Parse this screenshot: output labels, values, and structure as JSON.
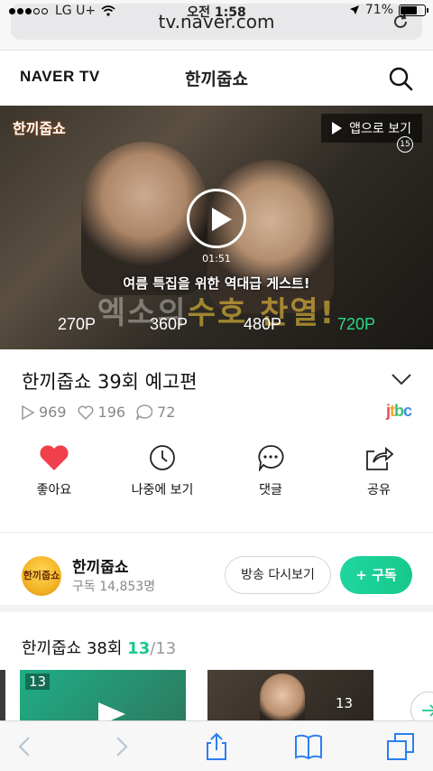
{
  "status_bar": {
    "carrier": "LG U+",
    "time": "오전 1:58",
    "battery": "71%",
    "battery_level": 0.71
  },
  "address_bar": {
    "url": "tv.naver.com"
  },
  "header": {
    "logo": "NAVER TV",
    "title": "한끼줍쇼"
  },
  "video": {
    "show_logo": "한끼줍쇼",
    "open_in_app": "앱으로 보기",
    "age_rating": "15",
    "duration": "01:51",
    "caption_top": "여름 특집을 위한 역대급 게스트!",
    "caption_main": "엑소의",
    "caption_highlight": "수호 찬열!",
    "qualities": [
      "270P",
      "360P",
      "480P",
      "720P"
    ],
    "selected_quality": "720P"
  },
  "info": {
    "title": "한끼줍쇼 39회 예고편",
    "plays": "969",
    "likes": "196",
    "comments": "72",
    "broadcaster": {
      "j": "j",
      "t": "t",
      "b": "b",
      "c": "c"
    }
  },
  "actions": [
    {
      "label": "좋아요",
      "icon": "heart-icon"
    },
    {
      "label": "나중에 보기",
      "icon": "clock-icon"
    },
    {
      "label": "댓글",
      "icon": "comment-icon"
    },
    {
      "label": "공유",
      "icon": "share-icon"
    }
  ],
  "channel": {
    "avatar_text": "한끼줍쇼",
    "name": "한끼줍쇼",
    "subscribers": "구독 14,853명",
    "replay_button": "방송 다시보기",
    "subscribe_button": "+ 구독"
  },
  "episodes": {
    "title": "한끼줍쇼 38회",
    "current": "13",
    "total": "/13",
    "thumbnails": [
      {
        "number": "13"
      },
      {
        "number": "13"
      }
    ]
  },
  "colors": {
    "accent": "#19c98a",
    "like": "#f1404b",
    "quality_active": "#2bd98a"
  }
}
